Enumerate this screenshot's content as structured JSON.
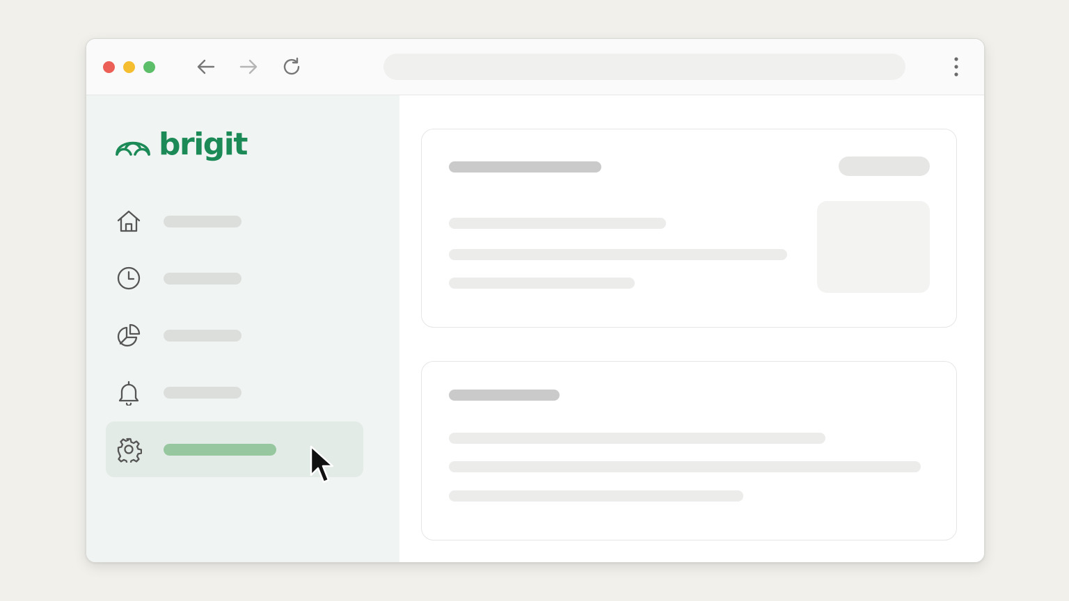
{
  "app": {
    "brand_name": "brigit",
    "brand_color": "#1b8a57"
  },
  "toolbar": {
    "traffic_lights": {
      "close": "#ec5f57",
      "minimize": "#f4be30",
      "maximize": "#5dbe6a"
    },
    "icons": [
      "back-arrow-icon",
      "forward-arrow-icon",
      "reload-icon",
      "more-vertical-icon"
    ],
    "address": ""
  },
  "sidebar": {
    "items": [
      {
        "icon": "home-icon",
        "label": "",
        "active": false
      },
      {
        "icon": "clock-icon",
        "label": "",
        "active": false
      },
      {
        "icon": "pie-chart-icon",
        "label": "",
        "active": false
      },
      {
        "icon": "bell-icon",
        "label": "",
        "active": false
      },
      {
        "icon": "gear-icon",
        "label": "",
        "active": true
      }
    ],
    "active_color": "#96c79f"
  },
  "main": {
    "cards": [
      {
        "title": "",
        "action": "",
        "lines": [
          "",
          "",
          ""
        ],
        "has_thumbnail": true
      },
      {
        "title": "",
        "lines": [
          "",
          "",
          ""
        ]
      }
    ]
  }
}
